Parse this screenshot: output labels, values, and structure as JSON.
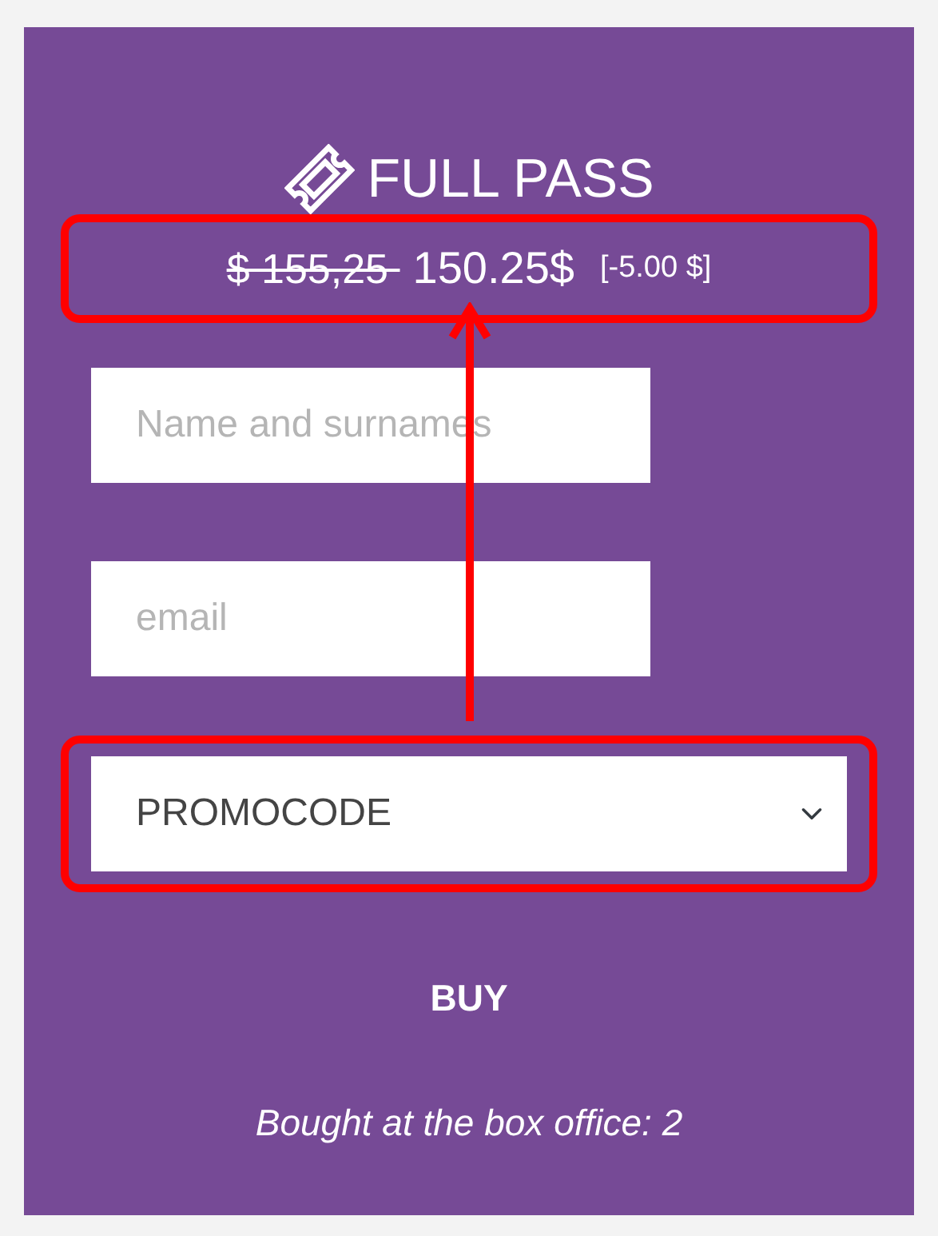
{
  "product": {
    "title": "FULL PASS"
  },
  "price": {
    "old": "$ 155,25 ",
    "new": "150.25$",
    "discount": "[-5.00 $]"
  },
  "fields": [
    {
      "placeholder": "Name and surnames"
    },
    {
      "placeholder": "email"
    }
  ],
  "promocode": {
    "value": "PROMOCODE"
  },
  "buy_button": {
    "label": "BUY"
  },
  "note": "Bought at the box office: 2"
}
